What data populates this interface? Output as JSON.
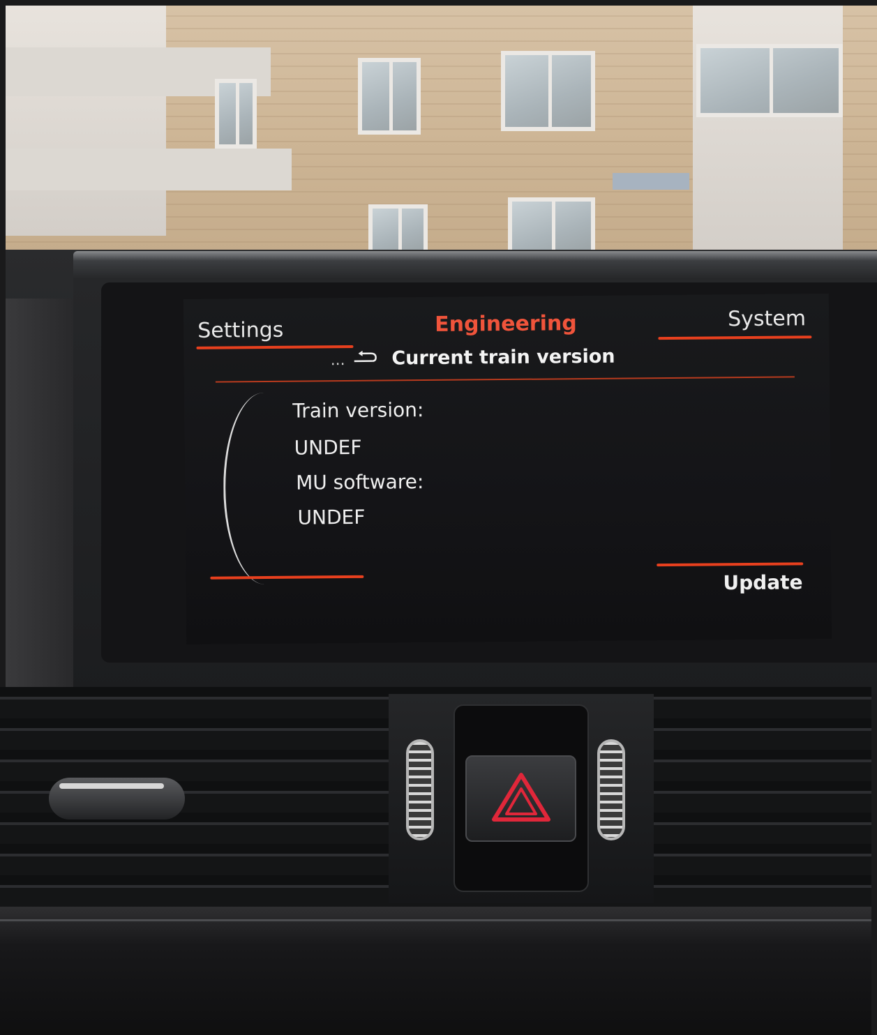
{
  "tabs": {
    "left": "Settings",
    "center": "Engineering",
    "right": "System"
  },
  "breadcrumb": {
    "prefix": "...",
    "title": "Current train version"
  },
  "content": {
    "train_version_label": "Train version:",
    "train_version_value": "UNDEF",
    "mu_software_label": "MU software:",
    "mu_software_value": "UNDEF"
  },
  "actions": {
    "update_label": "Update"
  },
  "icons": {
    "back": "back-arrow-icon",
    "hazard": "hazard-triangle-icon"
  },
  "colors": {
    "accent": "#e8401e",
    "title_active": "#f0543b",
    "text": "#f0f0f0",
    "screen_bg": "#151618",
    "hazard_red": "#e0273a"
  }
}
